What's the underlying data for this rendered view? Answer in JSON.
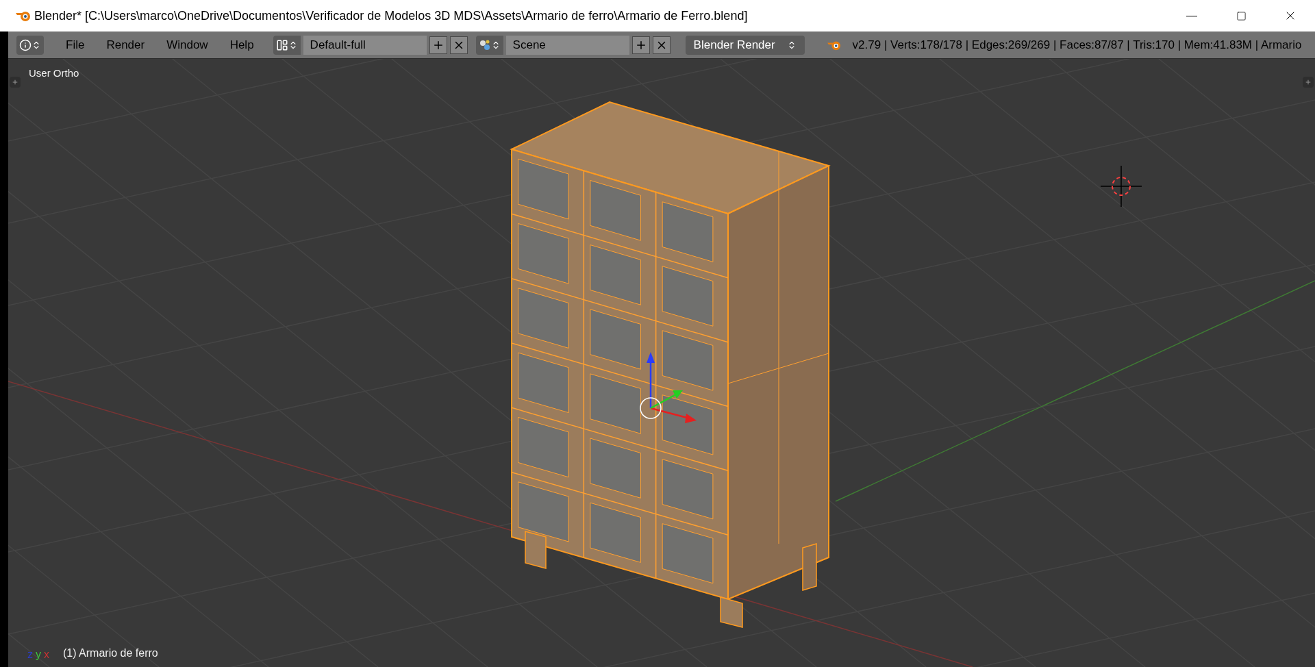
{
  "window": {
    "title": "Blender* [C:\\Users\\marco\\OneDrive\\Documentos\\Verificador de Modelos 3D MDS\\Assets\\Armario de ferro\\Armario de Ferro.blend]"
  },
  "menus": [
    {
      "label": "File"
    },
    {
      "label": "Render"
    },
    {
      "label": "Window"
    },
    {
      "label": "Help"
    }
  ],
  "screen_layout": {
    "value": "Default-full"
  },
  "scene": {
    "value": "Scene"
  },
  "render_engine": {
    "value": "Blender Render"
  },
  "stats": "v2.79 | Verts:178/178 | Edges:269/269 | Faces:87/87 | Tris:170 | Mem:41.83M | Armario",
  "viewport": {
    "view_name": "User Ortho",
    "object_label": "(1) Armario de ferro",
    "axes": [
      {
        "label": "z",
        "color": "#2c3cc8"
      },
      {
        "label": "y",
        "color": "#3cc83c"
      },
      {
        "label": "x",
        "color": "#c83232"
      }
    ]
  }
}
